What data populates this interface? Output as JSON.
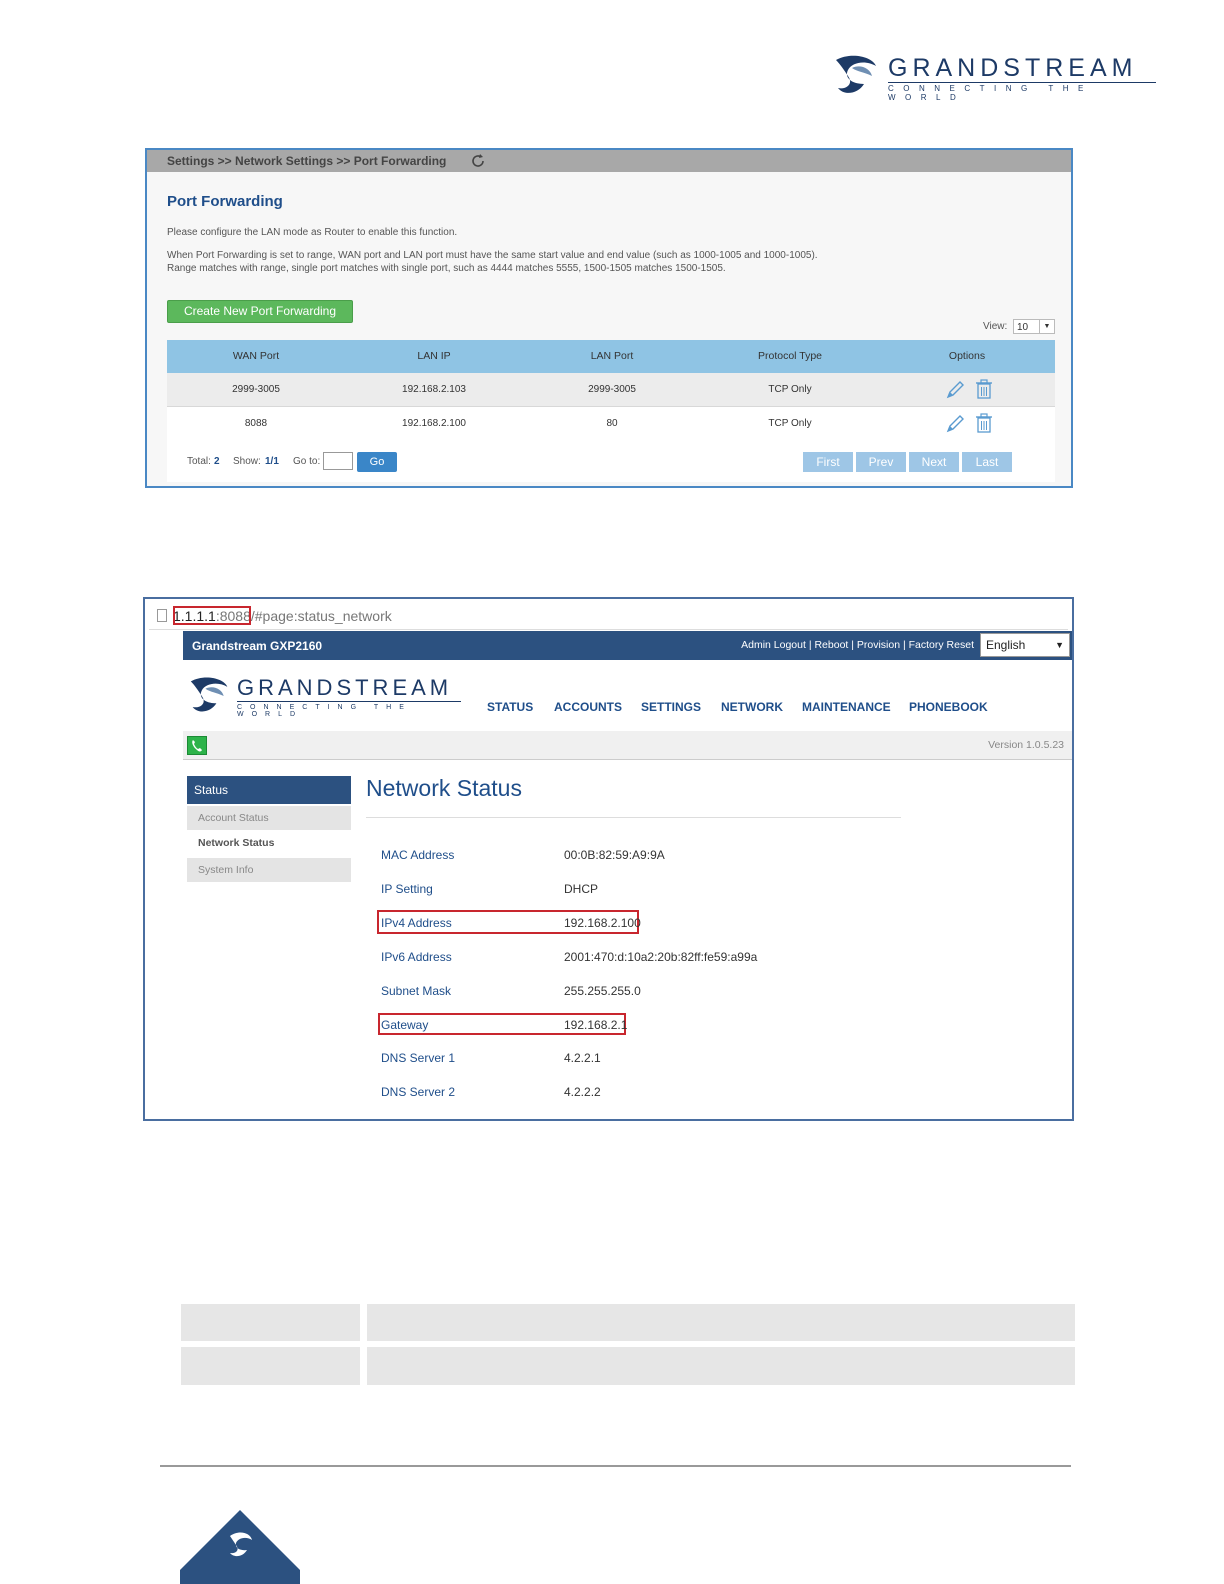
{
  "header_logo": {
    "word": "GRANDSTREAM",
    "tagline": "CONNECTING THE WORLD"
  },
  "port_forwarding": {
    "breadcrumb": "Settings >> Network Settings >> Port Forwarding",
    "title": "Port Forwarding",
    "note1": "Please configure the LAN mode as Router to enable this function.",
    "note2": "When Port Forwarding is set to range, WAN port and LAN port must have the same start value and end value (such as 1000-1005 and 1000-1005).",
    "note3": "Range matches with range, single port matches with single port, such as 4444 matches 5555, 1500-1505 matches 1500-1505.",
    "create_button": "Create New Port Forwarding",
    "view_label": "View:",
    "view_value": "10",
    "columns": [
      "WAN Port",
      "LAN IP",
      "LAN Port",
      "Protocol Type",
      "Options"
    ],
    "rows": [
      [
        "2999-3005",
        "192.168.2.103",
        "2999-3005",
        "TCP Only"
      ],
      [
        "8088",
        "192.168.2.100",
        "80",
        "TCP Only"
      ]
    ],
    "footer": {
      "total_label": "Total:",
      "total_value": "2",
      "show_label": "Show:",
      "show_value": "1/1",
      "goto_label": "Go to:",
      "go_button": "Go",
      "first": "First",
      "prev": "Prev",
      "next": "Next",
      "last": "Last"
    }
  },
  "network_status": {
    "address_host": "1.1.1.1",
    "address_port": ":8088",
    "address_rest": "/#page:status_network",
    "brand": "Grandstream GXP2160",
    "top_links": "Admin Logout | Reboot | Provision | Factory Reset",
    "language": "English",
    "logo_word": "GRANDSTREAM",
    "logo_tagline": "CONNECTING THE WORLD",
    "nav": [
      "STATUS",
      "ACCOUNTS",
      "SETTINGS",
      "NETWORK",
      "MAINTENANCE",
      "PHONEBOOK"
    ],
    "version": "Version 1.0.5.23",
    "sidebar": {
      "head": "Status",
      "items": [
        "Account Status",
        "Network Status",
        "System Info"
      ]
    },
    "heading": "Network Status",
    "fields": [
      {
        "label": "MAC Address",
        "value": "00:0B:82:59:A9:9A"
      },
      {
        "label": "IP Setting",
        "value": "DHCP"
      },
      {
        "label": "IPv4 Address",
        "value": "192.168.2.100"
      },
      {
        "label": "IPv6 Address",
        "value": "2001:470:d:10a2:20b:82ff:fe59:a99a"
      },
      {
        "label": "Subnet Mask",
        "value": "255.255.255.0"
      },
      {
        "label": "Gateway",
        "value": "192.168.2.1"
      },
      {
        "label": "DNS Server 1",
        "value": "4.2.2.1"
      },
      {
        "label": "DNS Server 2",
        "value": "4.2.2.2"
      }
    ]
  },
  "colors": {
    "brand_blue": "#2c5180",
    "highlight_red": "#c8262e",
    "create_green": "#5cb85c",
    "table_header": "#8fc4e4"
  }
}
